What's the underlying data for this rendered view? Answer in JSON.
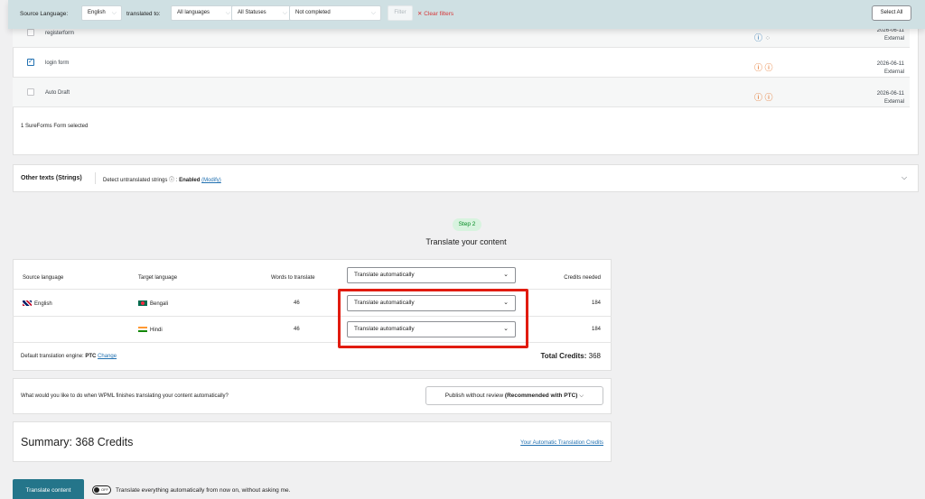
{
  "filter_bar": {
    "source_label": "Source Language:",
    "source_value": "English",
    "translated_to_label": "translated to:",
    "languages_value": "All languages",
    "statuses_value": "All Statuses",
    "completion_value": "Not completed",
    "filter_label": "Filter",
    "clear_label": "Clear filters",
    "select_all_label": "Select All"
  },
  "forms": {
    "rows": [
      {
        "name": "registerform",
        "date": "2026-06-11",
        "type": "External",
        "checked": false
      },
      {
        "name": "login form",
        "date": "2026-06-11",
        "type": "External",
        "checked": true
      },
      {
        "name": "Auto Draft",
        "date": "2026-06-11",
        "type": "External",
        "checked": false
      }
    ],
    "selected_text": "1 SureForms Form selected"
  },
  "strings": {
    "title": "Other texts (Strings)",
    "detect_label": "Detect untranslated strings",
    "status": "Enabled",
    "modify_label": "(Modify)"
  },
  "step": {
    "badge": "Step 2",
    "title": "Translate your content"
  },
  "translate_table": {
    "headers": {
      "source": "Source language",
      "target": "Target language",
      "words": "Words to translate",
      "method": "Translate automatically",
      "credits": "Credits needed"
    },
    "rows": [
      {
        "source": "English",
        "target": "Bengali",
        "words": "46",
        "method": "Translate automatically",
        "credits": "184"
      },
      {
        "source": "",
        "target": "Hindi",
        "words": "46",
        "method": "Translate automatically",
        "credits": "184"
      }
    ],
    "engine_label": "Default translation engine:",
    "engine_value": "PTC",
    "change_label": "Change",
    "total_label": "Total Credits:",
    "total_value": "368"
  },
  "question": {
    "text": "What would you like to do when WPML finishes translating your content automatically?",
    "select_value": "Publish without review",
    "select_recommended": "(Recommended with PTC)"
  },
  "summary": {
    "title": "Summary: 368 Credits",
    "link": "Your Automatic Translation Credits"
  },
  "footer": {
    "button_label": "Translate content",
    "toggle_label": "OFF",
    "auto_text": "Translate everything automatically from now on, without asking me."
  },
  "colors": {
    "primary_button": "#24758a",
    "highlight": "#e11b0f",
    "link": "#2271b1",
    "step_badge_bg": "#d8f3df",
    "filter_bar_bg": "#cfe0e3"
  },
  "icons": {
    "status_in_progress": "info-circle-icon",
    "status_pending": "spinner-icon",
    "status_attention": "warning-circle-icon",
    "help": "question-circle-icon",
    "expand": "chevron-down-icon"
  }
}
